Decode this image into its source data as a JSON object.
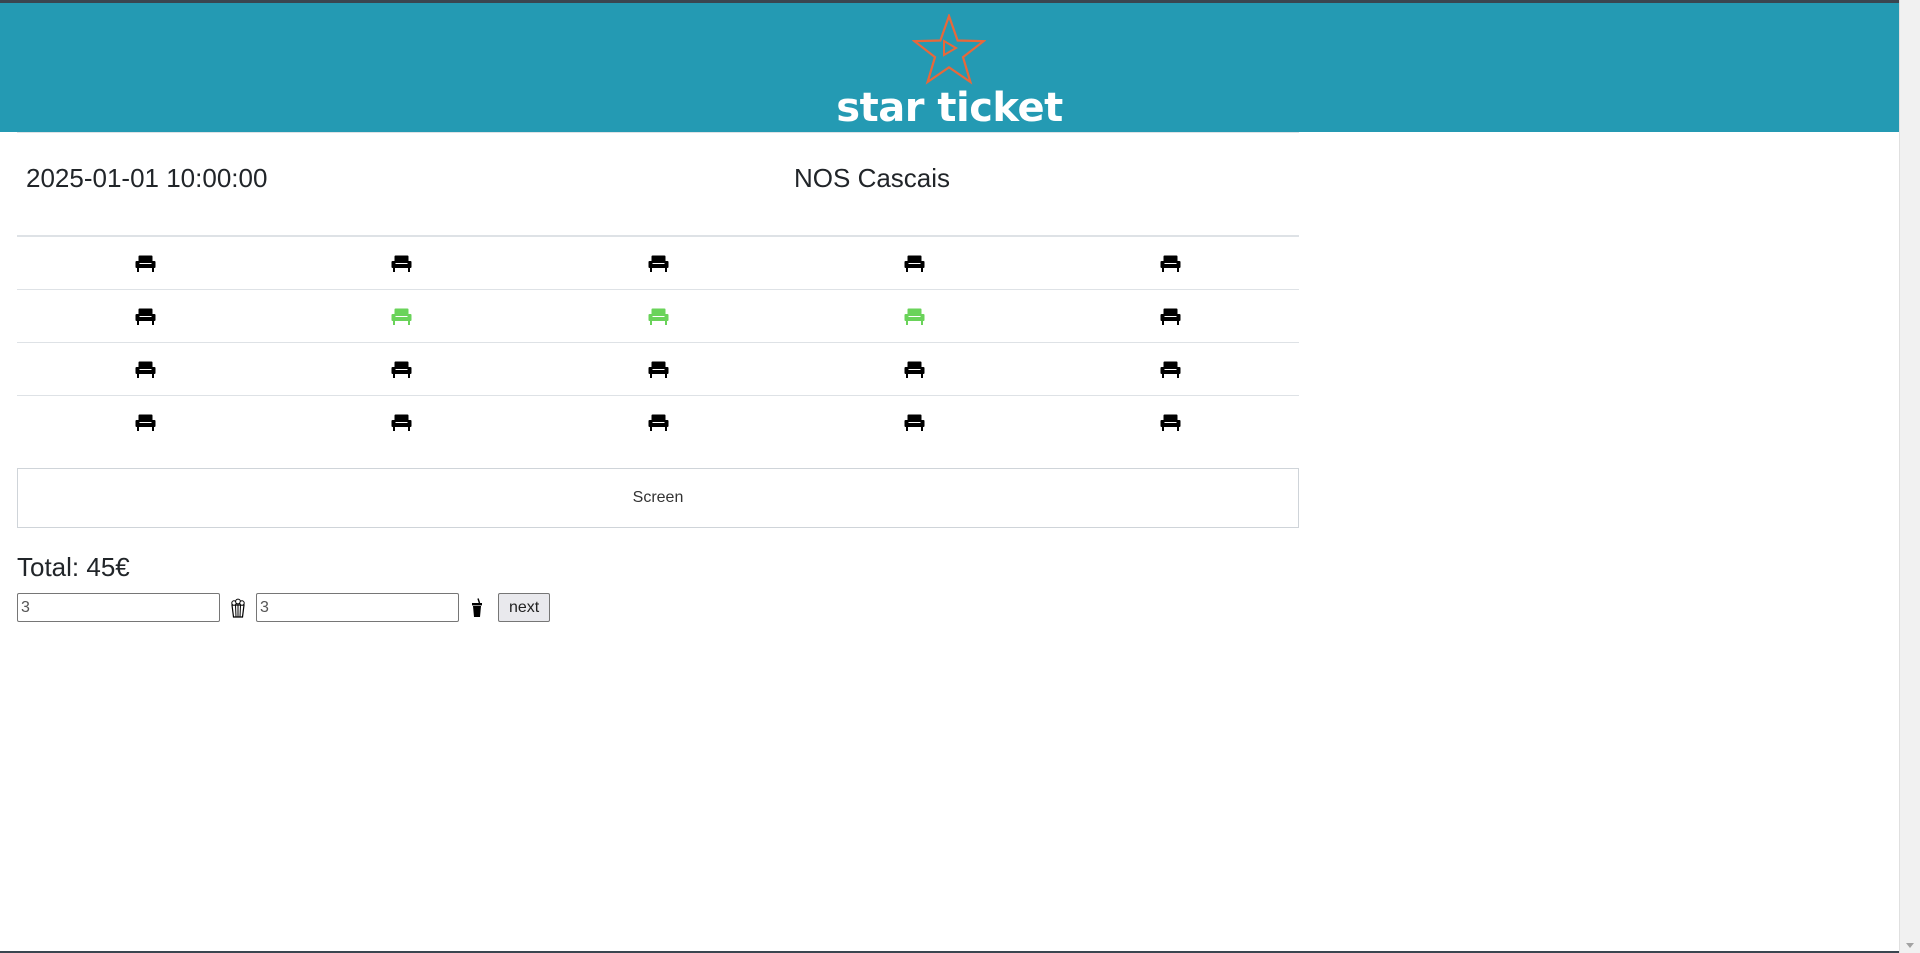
{
  "brand": {
    "name": "star ticket",
    "accent_color": "#249ab3",
    "logo_color": "#e8683a",
    "logo_icon": "star-play-icon"
  },
  "session": {
    "datetime": "2025-01-01 10:00:00",
    "cinema": "NOS Cascais"
  },
  "seat_colors": {
    "available": "#000000",
    "selected": "#6ad35a"
  },
  "seats": [
    [
      "available",
      "available",
      "available",
      "available",
      "available"
    ],
    [
      "available",
      "selected",
      "selected",
      "selected",
      "available"
    ],
    [
      "available",
      "available",
      "available",
      "available",
      "available"
    ],
    [
      "available",
      "available",
      "available",
      "available",
      "available"
    ]
  ],
  "screen_label": "Screen",
  "total": "Total: 45€",
  "popcorn": {
    "value": "3",
    "icon": "popcorn-icon"
  },
  "drink": {
    "value": "3",
    "icon": "drink-cup-icon"
  },
  "next_label": "next"
}
